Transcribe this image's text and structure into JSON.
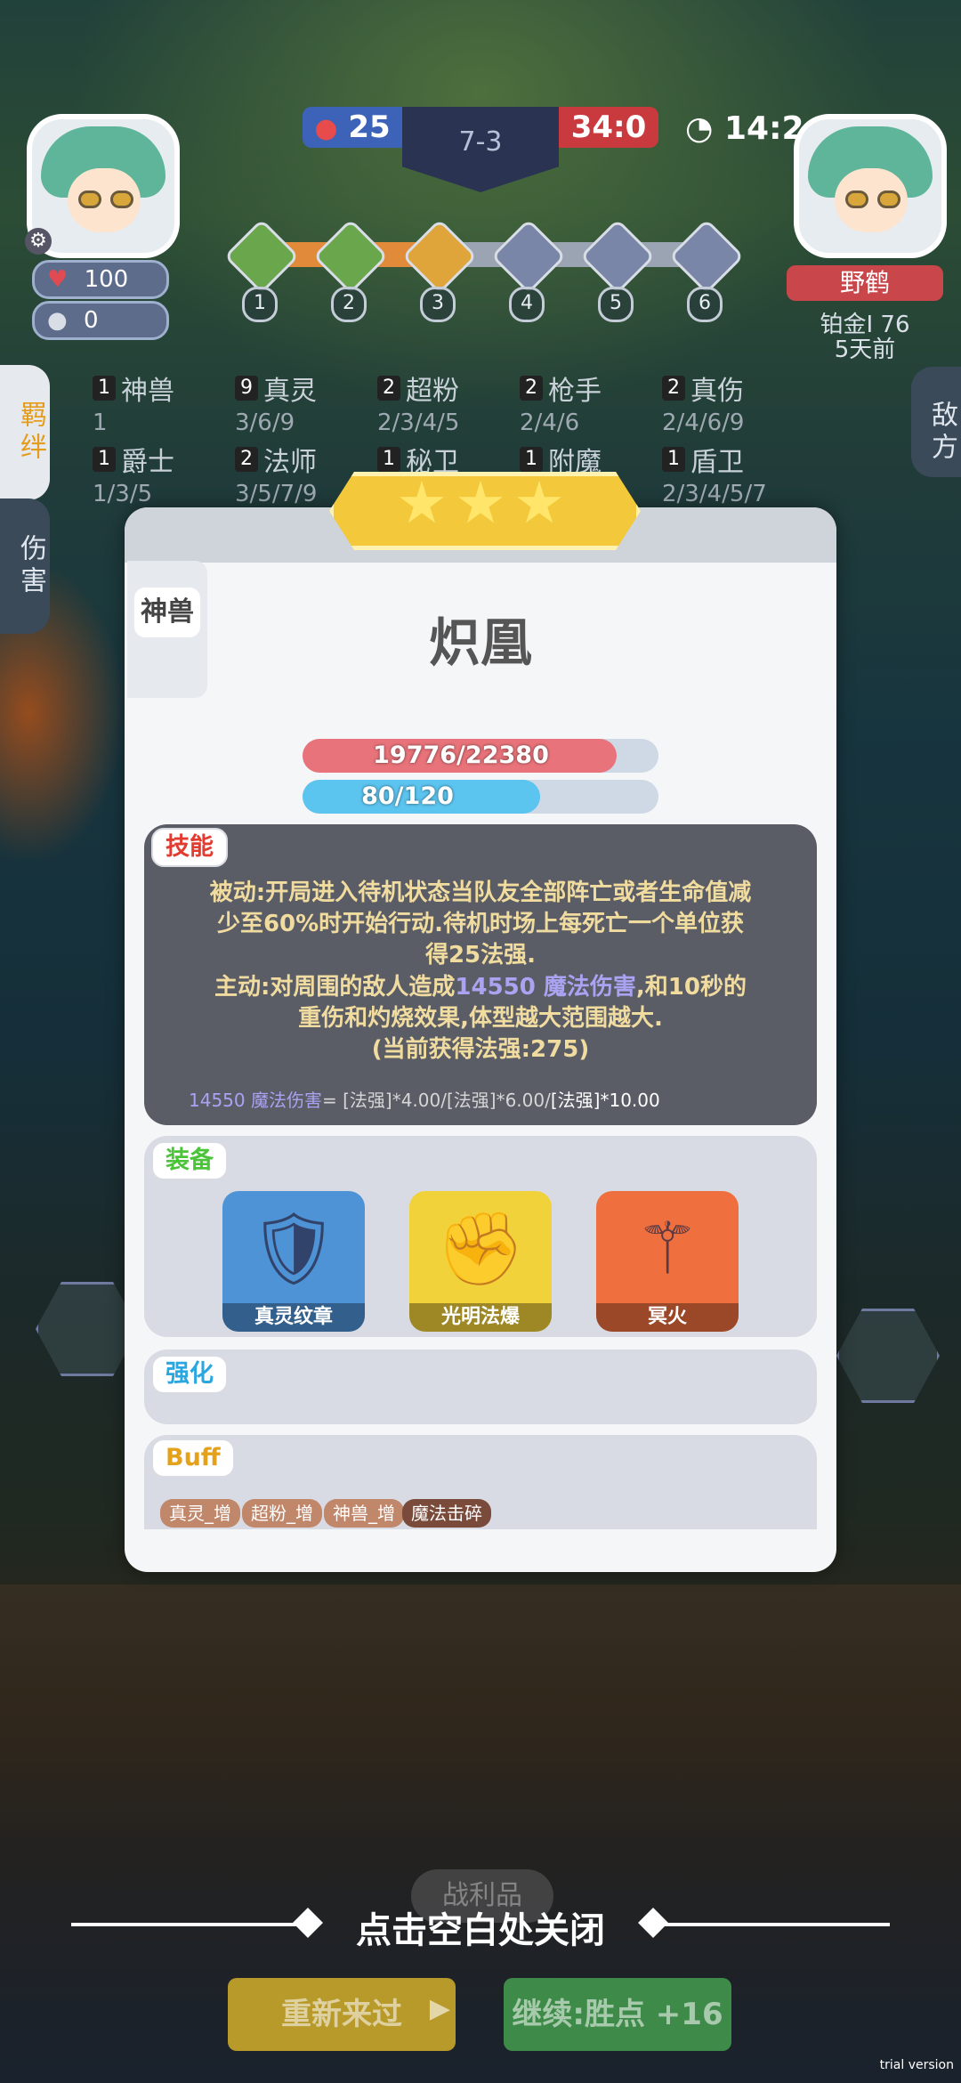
{
  "hud": {
    "player_hp": "100",
    "player_coins": "0",
    "blue_score": "25",
    "round": "7-3",
    "red_score": "34:0",
    "timer": "14:2",
    "stages": [
      "1",
      "2",
      "3",
      "4",
      "5",
      "6"
    ],
    "stage_progress": 0.45,
    "enemy_name": "野鹤",
    "enemy_rank": "铂金I 76",
    "enemy_time": "5天前"
  },
  "side_tabs": {
    "bond": "羁绊",
    "damage": "伤害",
    "enemy": "敌方"
  },
  "traits": [
    {
      "count": "1",
      "name": "神兽",
      "levels": "1"
    },
    {
      "count": "9",
      "name": "真灵",
      "levels": "3/6/9"
    },
    {
      "count": "2",
      "name": "超粉",
      "levels": "2/3/4/5"
    },
    {
      "count": "2",
      "name": "枪手",
      "levels": "2/4/6"
    },
    {
      "count": "2",
      "name": "真伤",
      "levels": "2/4/6/9"
    },
    {
      "count": "1",
      "name": "爵士",
      "levels": "1/3/5"
    },
    {
      "count": "2",
      "name": "法师",
      "levels": "3/5/7/9"
    },
    {
      "count": "1",
      "name": "秘卫",
      "levels": ""
    },
    {
      "count": "1",
      "name": "附魔",
      "levels": ""
    },
    {
      "count": "1",
      "name": "盾卫",
      "levels": "2/3/4/5/7"
    }
  ],
  "unit": {
    "class": "神兽",
    "name": "炽凰",
    "hp_text": "19776/22380",
    "hp_ratio": 0.8836,
    "mana_text": "80/120",
    "mana_ratio": 0.6667
  },
  "skill": {
    "label": "技能",
    "line1": "被动:开局进入待机状态当队友全部阵亡或者生命值减",
    "line2": "少至60%时开始行动.待机时场上每死亡一个单位获",
    "line3": "得25法强.",
    "line4_pre": "主动:对周围的敌人造成",
    "line4_dmg": "14550 魔法伤害",
    "line4_post": ",和10秒的",
    "line5": "重伤和灼烧效果,体型越大范围越大.",
    "line6": "(当前获得法强:275)",
    "formula_dmg": "14550 魔法伤害",
    "formula_rest": "= [法强]*4.00/[法强]*6.00/",
    "formula_last": "[法强]*10.00"
  },
  "equipment": {
    "label": "装备",
    "items": [
      {
        "name": "真灵纹章",
        "icon": "shield-emblem-icon",
        "bg": "#4e93d6"
      },
      {
        "name": "光明法爆",
        "icon": "dragon-gauntlet-icon",
        "bg": "#f2d23a"
      },
      {
        "name": "冥火",
        "icon": "dark-staff-icon",
        "bg": "#ef6f3e"
      }
    ]
  },
  "enhance": {
    "label": "强化"
  },
  "buff": {
    "label": "Buff",
    "items": [
      "真灵_增",
      "超粉_增",
      "神兽_增",
      "魔法击碎"
    ]
  },
  "bottom": {
    "faint_tab": "战利品",
    "close_hint": "点击空白处关闭",
    "retry": "重新来过",
    "continue": "继续:胜点 +16"
  },
  "watermark": "trial version",
  "colors": {
    "hp": "#e8737a",
    "mana": "#5bc4ef",
    "skill_bg": "#5a5c66",
    "label_orange": "#e23b2f",
    "label_green": "#4cc43a",
    "label_blue": "#2aa7e0",
    "label_gold": "#e3a21a"
  }
}
